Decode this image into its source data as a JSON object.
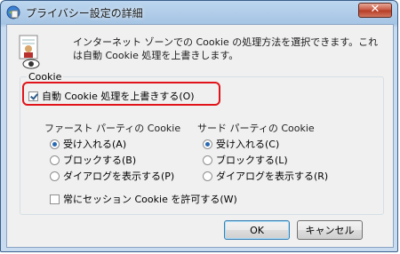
{
  "window": {
    "title": "プライバシー設定の詳細",
    "close_label": "✕"
  },
  "description": "インターネット ゾーンでの Cookie の処理方法を選択できます。これは自動 Cookie 処理を上書きします。",
  "cookie_group": {
    "label": "Cookie",
    "override_label": "自動 Cookie 処理を上書きする(O)",
    "override_checked": true
  },
  "first_party": {
    "heading": "ファースト パーティの Cookie",
    "options": [
      "受け入れる(A)",
      "ブロックする(B)",
      "ダイアログを表示する(P)"
    ],
    "selected": 0
  },
  "third_party": {
    "heading": "サード パーティの Cookie",
    "options": [
      "受け入れる(C)",
      "ブロックする(L)",
      "ダイアログを表示する(R)"
    ],
    "selected": 0
  },
  "session": {
    "label": "常にセッション Cookie を許可する(W)",
    "checked": false
  },
  "buttons": {
    "ok": "OK",
    "cancel": "キャンセル"
  },
  "colors": {
    "highlight": "#e0141a"
  }
}
